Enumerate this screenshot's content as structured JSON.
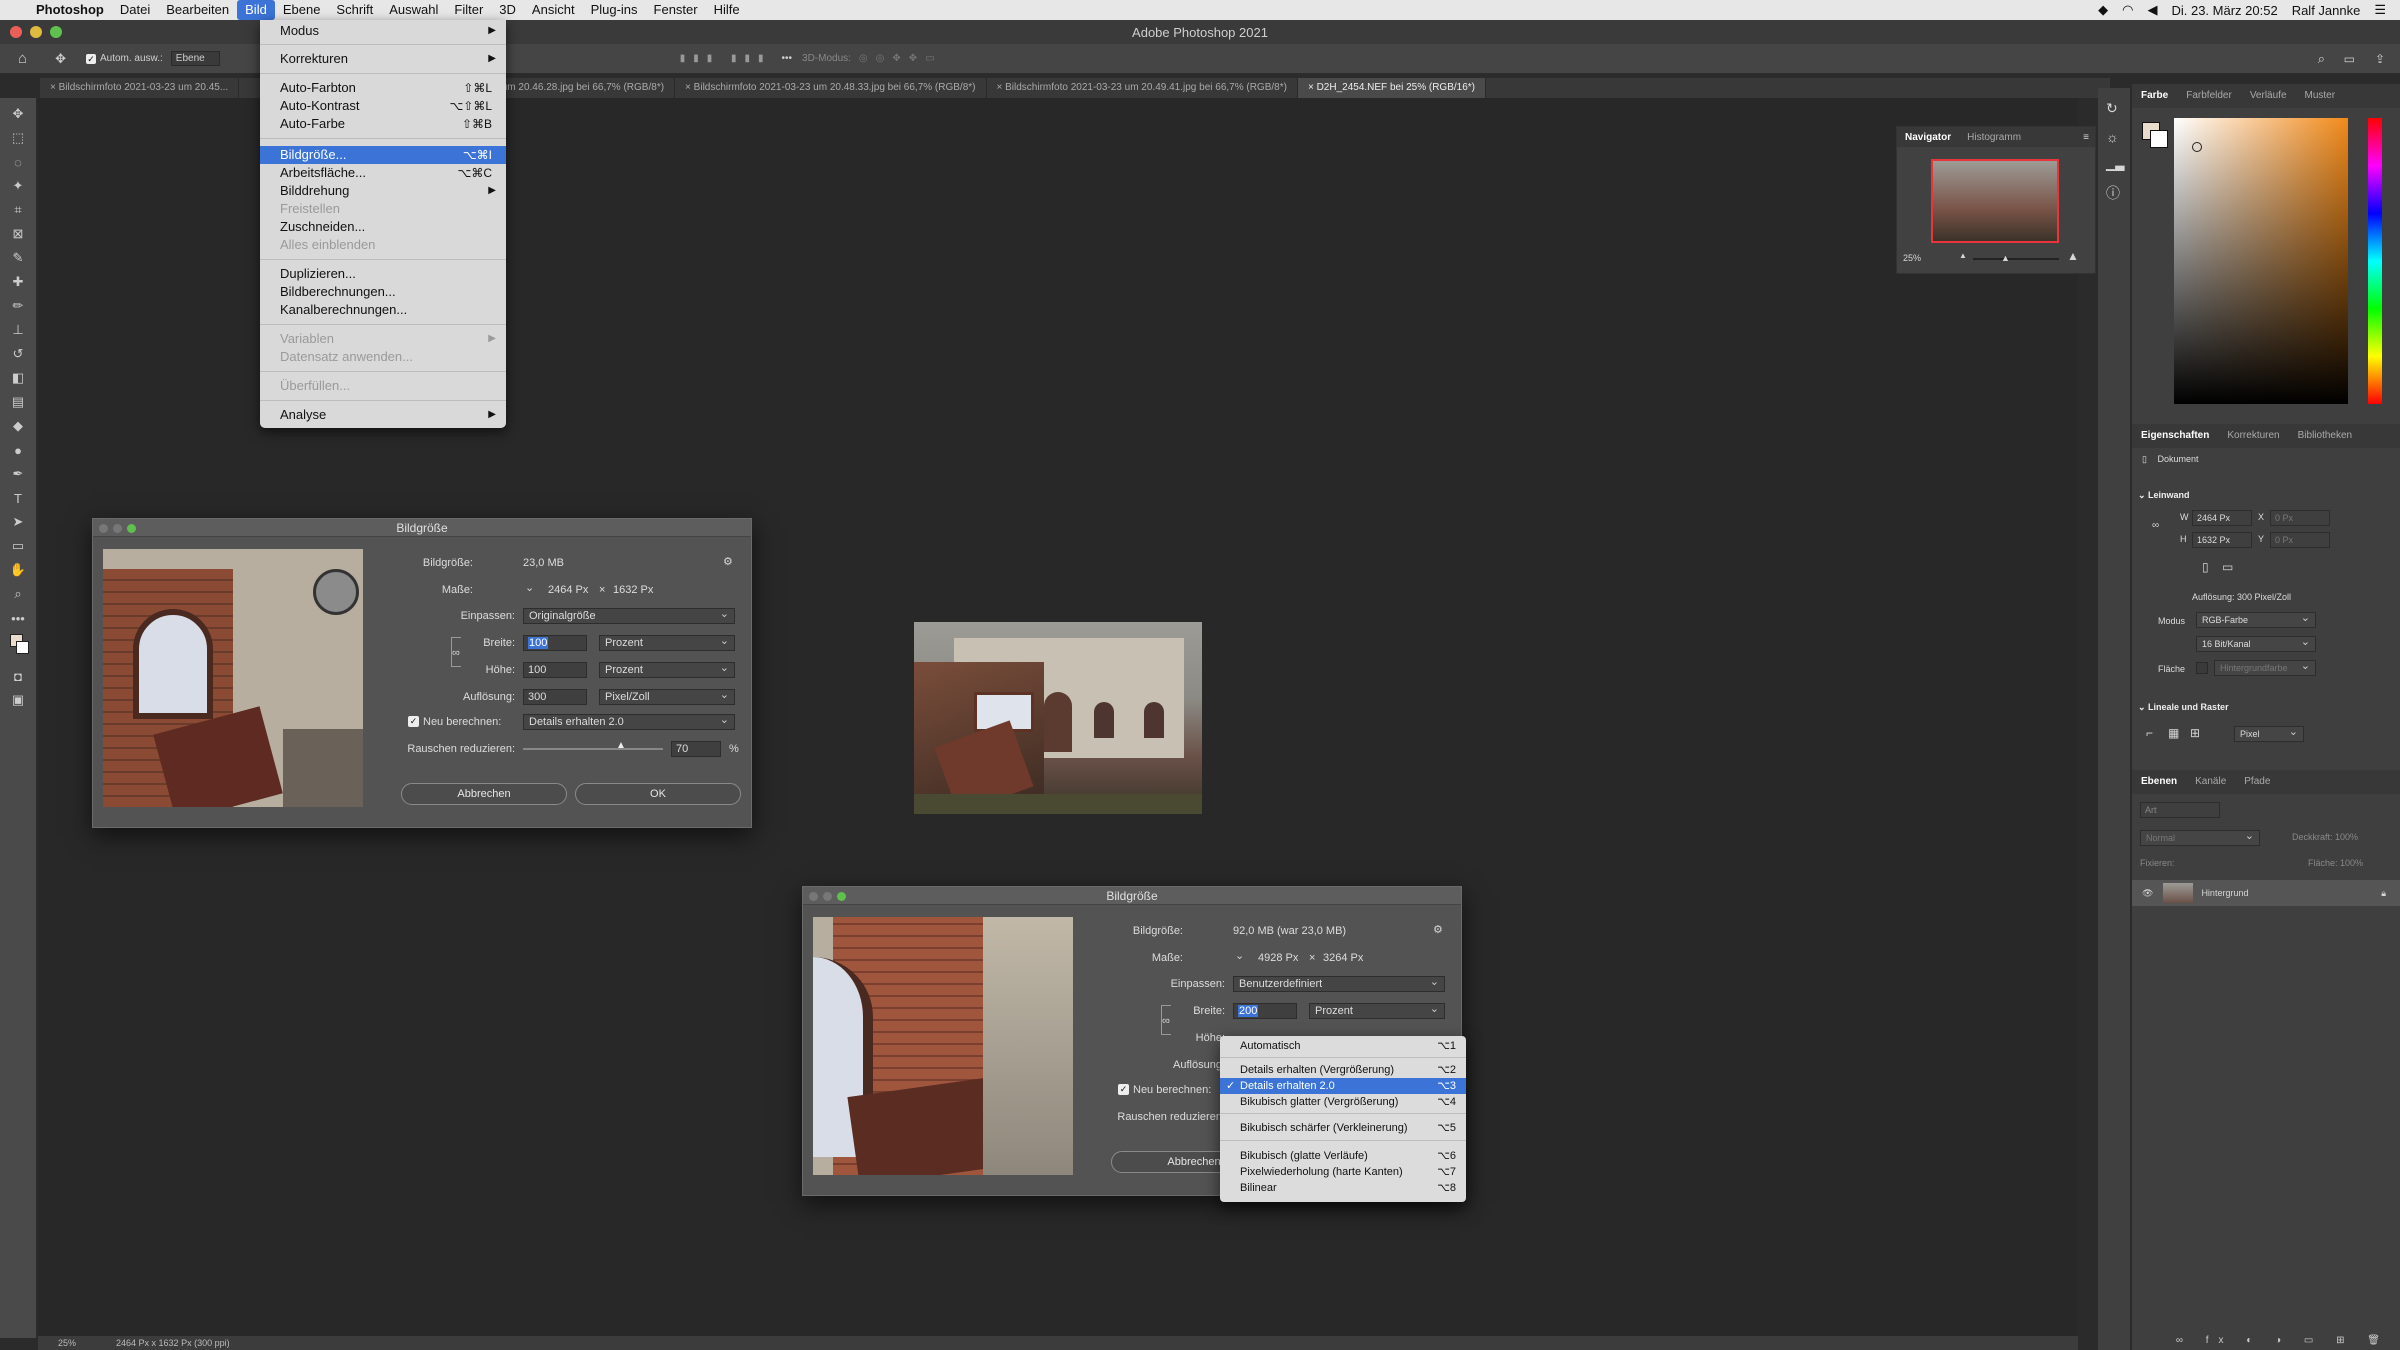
{
  "menubar": {
    "apple": "",
    "app": "Photoshop",
    "items": [
      "Datei",
      "Bearbeiten",
      "Bild",
      "Ebene",
      "Schrift",
      "Auswahl",
      "Filter",
      "3D",
      "Ansicht",
      "Plug-ins",
      "Fenster",
      "Hilfe"
    ],
    "active": "Bild",
    "clock": "Di. 23. März 20:52",
    "user": "Ralf Jannke"
  },
  "window": {
    "title": "Adobe Photoshop 2021"
  },
  "optionsbar": {
    "auto_select": "Autom. ausw.:",
    "auto_select_target": "Ebene",
    "mode3d": "3D-Modus:"
  },
  "tabs": [
    {
      "label": "Bildschirmfoto 2021-03-23 um 20.45...",
      "active": false
    },
    {
      "label": "2021-03-23 um 20.46.28.jpg bei 66,7% (RGB/8*)",
      "active": false
    },
    {
      "label": "Bildschirmfoto 2021-03-23 um 20.48.33.jpg bei 66,7% (RGB/8*)",
      "active": false
    },
    {
      "label": "Bildschirmfoto 2021-03-23 um 20.49.41.jpg bei 66,7% (RGB/8*)",
      "active": false
    },
    {
      "label": "D2H_2454.NEF bei 25% (RGB/16*)",
      "active": true
    }
  ],
  "bild_menu": {
    "modus": "Modus",
    "korrekturen": "Korrekturen",
    "auto_farbton": "Auto-Farbton",
    "auto_farbton_sc": "⇧⌘L",
    "auto_kontrast": "Auto-Kontrast",
    "auto_kontrast_sc": "⌥⇧⌘L",
    "auto_farbe": "Auto-Farbe",
    "auto_farbe_sc": "⇧⌘B",
    "bildgroesse": "Bildgröße...",
    "bildgroesse_sc": "⌥⌘I",
    "arbeitsflaeche": "Arbeitsfläche...",
    "arbeitsflaeche_sc": "⌥⌘C",
    "bilddrehung": "Bilddrehung",
    "freistellen": "Freistellen",
    "zuschneiden": "Zuschneiden...",
    "alles_einblenden": "Alles einblenden",
    "duplizieren": "Duplizieren...",
    "bildberechnungen": "Bildberechnungen...",
    "kanalberechnungen": "Kanalberechnungen...",
    "variablen": "Variablen",
    "datensatz": "Datensatz anwenden...",
    "ueberfuellen": "Überfüllen...",
    "analyse": "Analyse"
  },
  "dialog1": {
    "title": "Bildgröße",
    "bildgroesse_label": "Bildgröße:",
    "bildgroesse": "23,0 MB",
    "masse_label": "Maße:",
    "masse_w": "2464 Px",
    "masse_x": "×",
    "masse_h": "1632 Px",
    "einpassen_label": "Einpassen:",
    "einpassen": "Originalgröße",
    "breite_label": "Breite:",
    "breite": "100",
    "breite_unit": "Prozent",
    "hoehe_label": "Höhe:",
    "hoehe": "100",
    "hoehe_unit": "Prozent",
    "aufloesung_label": "Auflösung:",
    "aufloesung": "300",
    "aufloesung_unit": "Pixel/Zoll",
    "neu_label": "Neu berechnen:",
    "neu": "Details erhalten 2.0",
    "rauschen_label": "Rauschen reduzieren:",
    "rauschen": "70",
    "rauschen_unit": "%",
    "rauschen_level": 0.7,
    "cancel": "Abbrechen",
    "ok": "OK"
  },
  "dialog2": {
    "title": "Bildgröße",
    "bildgroesse_label": "Bildgröße:",
    "bildgroesse": "92,0 MB (war 23,0 MB)",
    "masse_label": "Maße:",
    "masse_w": "4928 Px",
    "masse_x": "×",
    "masse_h": "3264 Px",
    "einpassen_label": "Einpassen:",
    "einpassen": "Benutzerdefiniert",
    "breite_label": "Breite:",
    "breite": "200",
    "breite_unit": "Prozent",
    "hoehe_label": "Höhe:",
    "aufloesung_label": "Auflösung:",
    "neu_label": "Neu berechnen:",
    "rauschen_label": "Rauschen reduzieren:",
    "cancel": "Abbrechen"
  },
  "resample_popup": {
    "items": [
      {
        "label": "Automatisch",
        "sc": "⌥1"
      },
      {
        "label": "Details erhalten (Vergrößerung)",
        "sc": "⌥2"
      },
      {
        "label": "Details erhalten 2.0",
        "sc": "⌥3",
        "checked": true
      },
      {
        "label": "Bikubisch glatter (Vergrößerung)",
        "sc": "⌥4"
      },
      {
        "label": "Bikubisch schärfer (Verkleinerung)",
        "sc": "⌥5"
      },
      {
        "label": "Bikubisch (glatte Verläufe)",
        "sc": "⌥6"
      },
      {
        "label": "Pixelwiederholung (harte Kanten)",
        "sc": "⌥7"
      },
      {
        "label": "Bilinear",
        "sc": "⌥8"
      }
    ]
  },
  "navigator": {
    "tab1": "Navigator",
    "tab2": "Histogramm",
    "zoom": "25%"
  },
  "color_panel": {
    "tabs": [
      "Farbe",
      "Farbfelder",
      "Verläufe",
      "Muster"
    ]
  },
  "properties": {
    "tabs": [
      "Eigenschaften",
      "Korrekturen",
      "Bibliotheken"
    ],
    "dokument": "Dokument",
    "leinwand": "Leinwand",
    "w_label": "W",
    "w": "2464 Px",
    "x_label": "X",
    "x": "0 Px",
    "h_label": "H",
    "h": "1632 Px",
    "y_label": "Y",
    "y": "0 Px",
    "aufloesung": "Auflösung: 300 Pixel/Zoll",
    "modus_label": "Modus",
    "modus": "RGB-Farbe",
    "bit": "16 Bit/Kanal",
    "flaeche_label": "Fläche",
    "flaeche": "Hintergrundfarbe",
    "lineale": "Lineale und Raster",
    "unit": "Pixel"
  },
  "layers": {
    "tabs": [
      "Ebenen",
      "Kanäle",
      "Pfade"
    ],
    "search": "Art",
    "blend": "Normal",
    "deckkraft": "Deckkraft: 100%",
    "fixieren": "Fixieren:",
    "flaeche": "Fläche: 100%",
    "layer_name": "Hintergrund"
  },
  "statusbar": {
    "zoom": "25%",
    "info": "2464 Px x 1632 Px (300 ppi)"
  }
}
